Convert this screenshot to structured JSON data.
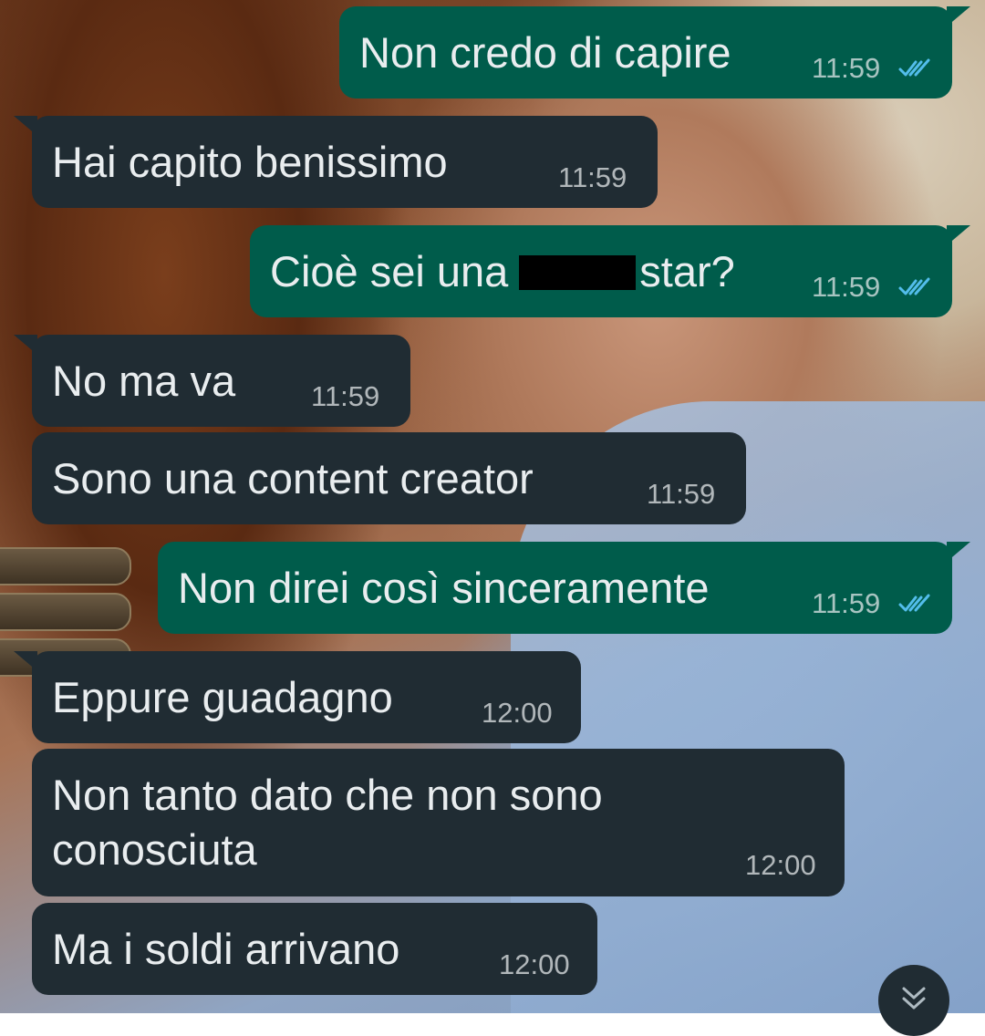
{
  "chat": {
    "messages": [
      {
        "direction": "outgoing",
        "text": "Non credo di capire",
        "time": "11:59",
        "status": "read"
      },
      {
        "direction": "incoming",
        "text": "Hai capito benissimo",
        "time": "11:59"
      },
      {
        "direction": "outgoing",
        "text_before": "Cioè sei una",
        "text_after": "star?",
        "time": "11:59",
        "status": "read"
      },
      {
        "direction": "incoming",
        "text": "No ma va",
        "time": "11:59"
      },
      {
        "direction": "incoming",
        "text": "Sono una content creator",
        "time": "11:59"
      },
      {
        "direction": "outgoing",
        "text": "Non direi così sinceramente",
        "time": "11:59",
        "status": "read"
      },
      {
        "direction": "incoming",
        "text": "Eppure guadagno",
        "time": "12:00"
      },
      {
        "direction": "incoming",
        "text_line1": "Non tanto dato che non sono",
        "text_line2": "conosciuta",
        "time": "12:00"
      },
      {
        "direction": "incoming",
        "text": "Ma i soldi arrivano",
        "time": "12:00"
      }
    ],
    "scroll_down_icon": "double-chevron-down-icon"
  },
  "colors": {
    "outgoing_bubble": "#005c4b",
    "incoming_bubble": "#202c33",
    "read_ticks": "#53bdeb",
    "text": "#e9edef"
  }
}
